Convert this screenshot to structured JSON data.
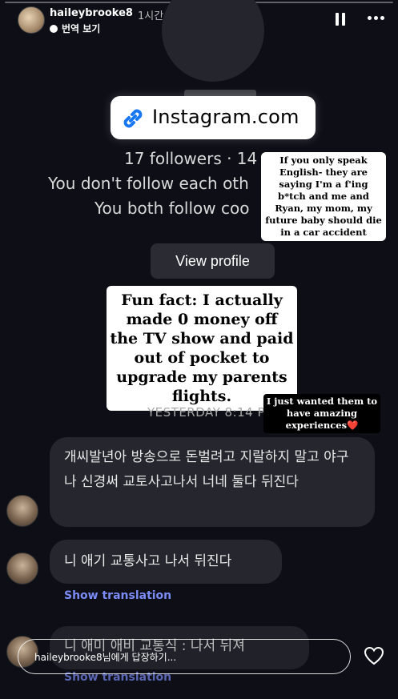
{
  "story": {
    "progress_fraction": 0,
    "header": {
      "username": "haileybrooke8",
      "time_ago": "1시간",
      "translate_label": "번역 보기"
    },
    "icons": {
      "pause": "pause-icon",
      "more": "more-icon",
      "link": "link-icon",
      "heart": "heart-icon"
    }
  },
  "screenshot": {
    "banner_text": "Instagram.com",
    "followers_line": "17 followers · 14 p",
    "follow_each_line": "You don't follow each oth",
    "follow_both_line": "You both follow coo",
    "view_profile_label": "View profile",
    "timestamp": "YESTERDAY 8:14 PM",
    "messages": [
      {
        "text": "개씨발년아 방송으로 돈벌려고 지랄하지 말고 야구나 신경써 교토사고나서 너네 둘다 뒤진다"
      },
      {
        "text": "니 애기 교통사고 나서 뒤진다",
        "show_translation": "Show translation"
      },
      {
        "text": "니 애미 애비 교통식 : 나서 뒤져",
        "show_translation": "Show translation"
      }
    ]
  },
  "captions": {
    "caption_1": "If you only speak English- they are saying I'm a f'ing b*tch and me and Ryan, my mom, my future baby should die in a car accident",
    "caption_2": "Fun fact: I actually made 0 money off the TV show and paid out of pocket to upgrade my parents flights.",
    "caption_3": "I just wanted them to have amazing experiences❤️"
  },
  "reply": {
    "placeholder": "haileybrooke8님에게 답장하기..."
  },
  "colors": {
    "background": "#0d0e16",
    "bubble": "#26272e",
    "link_blue": "#7c8cf7",
    "banner_icon": "#1877f2"
  }
}
